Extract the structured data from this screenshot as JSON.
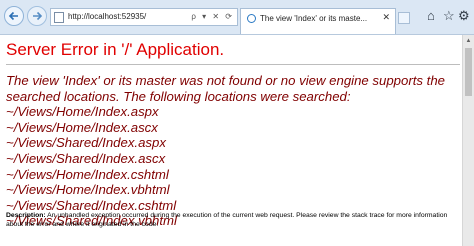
{
  "browser": {
    "address_url": "http://localhost:52935/",
    "address_tools": "ρ ▾ ✕ ⟳",
    "tab_title": "The view 'Index' or its maste...",
    "tab_close": "✕",
    "icons": [
      "back-icon",
      "forward-icon",
      "page-icon",
      "ie-icon",
      "home-icon",
      "favorites-star-icon",
      "gear-icon"
    ]
  },
  "page": {
    "title": "Server Error in '/' Application.",
    "message_lines": [
      "The view 'Index' or its master was not found or no view engine supports the",
      "searched locations. The following locations were searched:",
      "~/Views/Home/Index.aspx",
      "~/Views/Home/Index.ascx",
      "~/Views/Shared/Index.aspx",
      "~/Views/Shared/Index.ascx",
      "~/Views/Home/Index.cshtml",
      "~/Views/Home/Index.vbhtml",
      "~/Views/Shared/Index.cshtml",
      "~/Views/Shared/Index.vbhtml"
    ],
    "description_label": "Description:",
    "description_text": " An unhandled exception occurred during the execution of the current web request. Please review the stack trace for more information about the error and where it originated in the code."
  },
  "colors": {
    "title": "#e00000",
    "message": "#800000",
    "chrome": "#dbe7f4"
  }
}
